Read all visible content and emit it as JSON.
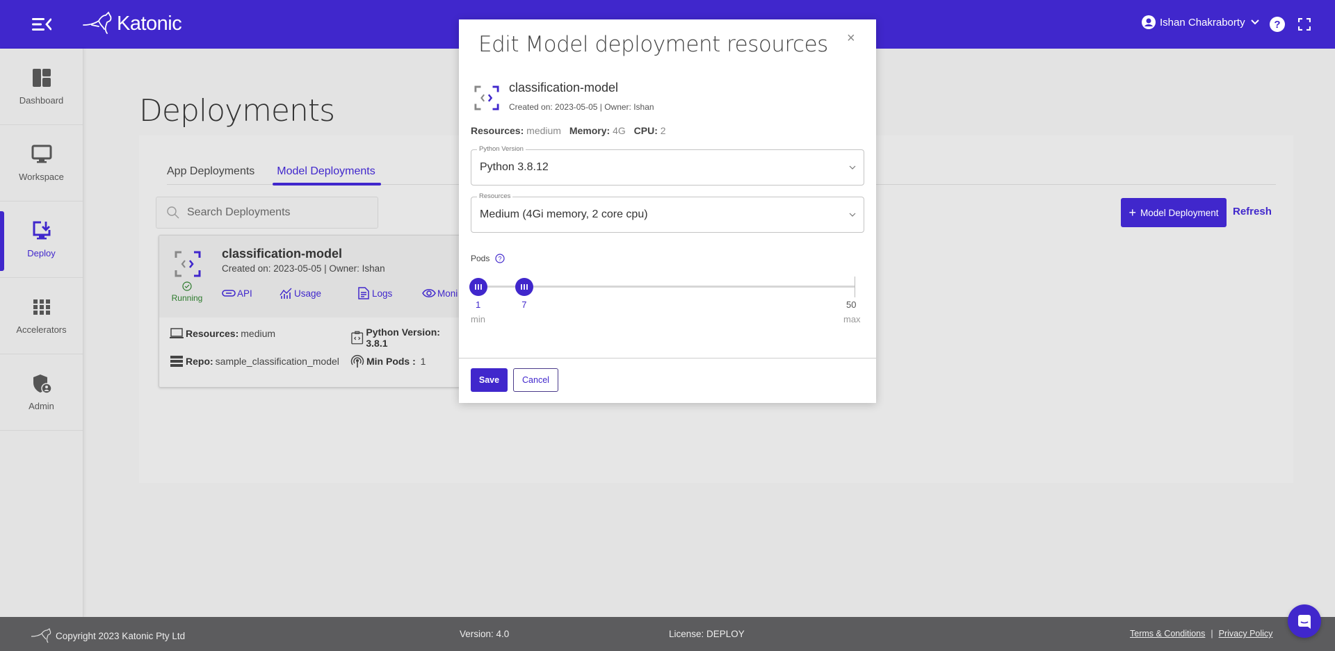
{
  "colors": {
    "brand": "#4027cc",
    "running": "#2c7a2c",
    "footer_bg": "#5c5c5e"
  },
  "header": {
    "logo_text": "Katonic",
    "user_name": "Ishan Chakraborty",
    "icons": [
      "menu-collapse-icon",
      "kangaroo-logo-icon",
      "user-avatar-icon",
      "chevron-down-icon",
      "help-icon",
      "fullscreen-icon"
    ]
  },
  "sidebar": {
    "items": [
      {
        "label": "Dashboard",
        "icon": "dashboard-icon",
        "active": false
      },
      {
        "label": "Workspace",
        "icon": "monitor-icon",
        "active": false
      },
      {
        "label": "Deploy",
        "icon": "deploy-icon",
        "active": true
      },
      {
        "label": "Accelerators",
        "icon": "grid-icon",
        "active": false
      },
      {
        "label": "Admin",
        "icon": "admin-shield-icon",
        "active": false
      }
    ]
  },
  "main": {
    "title": "Deployments",
    "tabs": [
      {
        "label": "App Deployments",
        "active": false
      },
      {
        "label": "Model Deployments",
        "active": true
      }
    ],
    "search": {
      "placeholder": "Search Deployments",
      "value": ""
    },
    "add_button": "Model Deployment",
    "refresh_button": "Refresh",
    "card": {
      "name": "classification-model",
      "meta": "Created on: 2023-05-05 | Owner: Ishan",
      "status": "Running",
      "links": [
        "API",
        "Usage",
        "Logs",
        "Moni"
      ],
      "resources_label": "Resources:",
      "resources_value": "medium",
      "python_label": "Python Version: 3.8.1",
      "repo_label": "Repo:",
      "repo_value": "sample_classification_model",
      "min_pods_label": "Min Pods :",
      "min_pods_value": "1"
    }
  },
  "modal": {
    "title": "Edit Model deployment resources",
    "close": "×",
    "model_name": "classification-model",
    "model_meta": "Created on: 2023-05-05 | Owner: Ishan",
    "resources_label": "Resources:",
    "resources_value": "medium",
    "memory_label": "Memory:",
    "memory_value": "4G",
    "cpu_label": "CPU:",
    "cpu_value": "2",
    "python_field": {
      "label": "Python Version",
      "value": "Python 3.8.12"
    },
    "resources_field": {
      "label": "Resources",
      "value": "Medium (4Gi memory, 2 core cpu)"
    },
    "pods": {
      "label": "Pods",
      "range_min": 1,
      "range_max": 50,
      "selected_min": 1,
      "selected_max": 7,
      "min_value_label": "1",
      "max_value_label": "7",
      "end_label": "50",
      "min_text": "min",
      "max_text": "max"
    },
    "save": "Save",
    "cancel": "Cancel"
  },
  "footer": {
    "copyright": "Copyright 2023 Katonic Pty Ltd",
    "version": "Version: 4.0",
    "license": "License: DEPLOY",
    "terms": "Terms & Conditions",
    "separator": "|",
    "privacy": "Privacy Policy"
  }
}
